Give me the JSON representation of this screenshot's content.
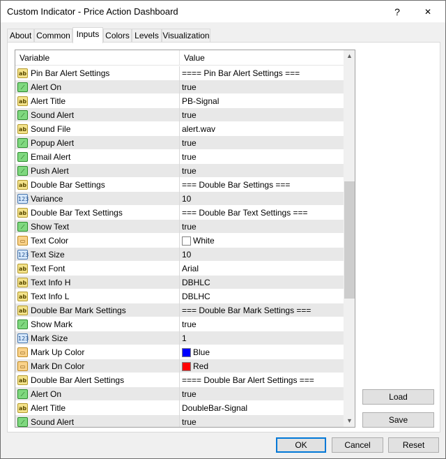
{
  "window": {
    "title": "Custom Indicator - Price Action Dashboard",
    "help_glyph": "?",
    "close_glyph": "✕"
  },
  "tabs": [
    {
      "label": "About"
    },
    {
      "label": "Common"
    },
    {
      "label": "Inputs"
    },
    {
      "label": "Colors"
    },
    {
      "label": "Levels"
    },
    {
      "label": "Visualization"
    }
  ],
  "active_tab": "Inputs",
  "grid": {
    "header_variable": "Variable",
    "header_value": "Value",
    "rows": [
      {
        "icon": "ab",
        "variable": "Pin Bar Alert Settings",
        "value": "==== Pin Bar Alert Settings ==="
      },
      {
        "icon": "bool",
        "variable": "Alert On",
        "value": "true"
      },
      {
        "icon": "ab",
        "variable": "Alert Title",
        "value": "PB-Signal"
      },
      {
        "icon": "bool",
        "variable": "Sound Alert",
        "value": "true"
      },
      {
        "icon": "ab",
        "variable": "Sound File",
        "value": "alert.wav"
      },
      {
        "icon": "bool",
        "variable": "Popup Alert",
        "value": "true"
      },
      {
        "icon": "bool",
        "variable": "Email Alert",
        "value": "true"
      },
      {
        "icon": "bool",
        "variable": "Push Alert",
        "value": "true"
      },
      {
        "icon": "ab",
        "variable": "Double Bar Settings",
        "value": " === Double Bar Settings ==="
      },
      {
        "icon": "num",
        "variable": "Variance",
        "value": "10"
      },
      {
        "icon": "ab",
        "variable": "Double Bar Text Settings",
        "value": " === Double Bar Text Settings ==="
      },
      {
        "icon": "bool",
        "variable": "Show Text",
        "value": "true"
      },
      {
        "icon": "color",
        "variable": "Text Color",
        "value": "White",
        "swatch": "#ffffff"
      },
      {
        "icon": "num",
        "variable": "Text Size",
        "value": "10"
      },
      {
        "icon": "ab",
        "variable": "Text Font",
        "value": "Arial"
      },
      {
        "icon": "ab",
        "variable": "Text Info H",
        "value": "DBHLC"
      },
      {
        "icon": "ab",
        "variable": "Text Info L",
        "value": "DBLHC"
      },
      {
        "icon": "ab",
        "variable": "Double Bar Mark Settings",
        "value": " === Double Bar Mark Settings ==="
      },
      {
        "icon": "bool",
        "variable": "Show Mark",
        "value": "true"
      },
      {
        "icon": "num",
        "variable": "Mark Size",
        "value": "1"
      },
      {
        "icon": "color",
        "variable": "Mark Up Color",
        "value": "Blue",
        "swatch": "#0000ff"
      },
      {
        "icon": "color",
        "variable": "Mark Dn Color",
        "value": "Red",
        "swatch": "#ff0000"
      },
      {
        "icon": "ab",
        "variable": "Double Bar Alert Settings",
        "value": "==== Double Bar Alert Settings ==="
      },
      {
        "icon": "bool",
        "variable": "Alert On",
        "value": "true"
      },
      {
        "icon": "ab",
        "variable": "Alert Title",
        "value": "DoubleBar-Signal"
      },
      {
        "icon": "bool",
        "variable": "Sound Alert",
        "value": "true"
      }
    ]
  },
  "icon_glyphs": {
    "ab": "ab",
    "bool": "⟋",
    "num": "123",
    "color": "▭"
  },
  "buttons": {
    "load": "Load",
    "save": "Save",
    "ok": "OK",
    "cancel": "Cancel",
    "reset": "Reset"
  },
  "scroll": {
    "up_glyph": "▲",
    "down_glyph": "▼"
  }
}
